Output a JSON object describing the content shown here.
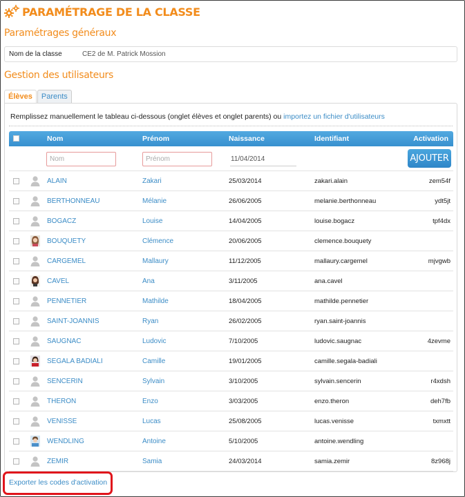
{
  "page": {
    "title": "PARAMÉTRAGE DE LA CLASSE",
    "section_general": "Paramétrages généraux",
    "section_users": "Gestion des utilisateurs"
  },
  "class_field": {
    "label": "Nom de la classe",
    "value": "CE2 de M. Patrick Mossion"
  },
  "tabs": [
    {
      "label": "Élèves",
      "active": true
    },
    {
      "label": "Parents",
      "active": false
    }
  ],
  "instructions": {
    "text": "Remplissez manuellement le tableau ci-dessous (onglet élèves et onglet parents) ou",
    "link": "importez un fichier d'utilisateurs"
  },
  "table": {
    "headers": {
      "nom": "Nom",
      "prenom": "Prénom",
      "naissance": "Naissance",
      "identifiant": "Identifiant",
      "activation": "Activation"
    },
    "add_row": {
      "nom_placeholder": "Nom",
      "prenom_placeholder": "Prénom",
      "date_value": "11/04/2014",
      "add_button": "AJOUTER"
    },
    "rows": [
      {
        "nom": "ALAIN",
        "prenom": "Zakari",
        "naissance": "25/03/2014",
        "identifiant": "zakari.alain",
        "activation": "zem54f",
        "avatar": "default"
      },
      {
        "nom": "BERTHONNEAU",
        "prenom": "Mélanie",
        "naissance": "26/06/2005",
        "identifiant": "melanie.berthonneau",
        "activation": "ydt5jt",
        "avatar": "default"
      },
      {
        "nom": "BOGACZ",
        "prenom": "Louise",
        "naissance": "14/04/2005",
        "identifiant": "louise.bogacz",
        "activation": "tpf4dx",
        "avatar": "default"
      },
      {
        "nom": "BOUQUETY",
        "prenom": "Clémence",
        "naissance": "20/06/2005",
        "identifiant": "clemence.bouquety",
        "activation": "",
        "avatar": "photo-girl"
      },
      {
        "nom": "CARGEMEL",
        "prenom": "Mallaury",
        "naissance": "11/12/2005",
        "identifiant": "mallaury.cargemel",
        "activation": "mjvgwb",
        "avatar": "default"
      },
      {
        "nom": "CAVEL",
        "prenom": "Ana",
        "naissance": "3/11/2005",
        "identifiant": "ana.cavel",
        "activation": "",
        "avatar": "photo-girl2"
      },
      {
        "nom": "PENNETIER",
        "prenom": "Mathilde",
        "naissance": "18/04/2005",
        "identifiant": "mathilde.pennetier",
        "activation": "",
        "avatar": "default"
      },
      {
        "nom": "SAINT-JOANNIS",
        "prenom": "Ryan",
        "naissance": "26/02/2005",
        "identifiant": "ryan.saint-joannis",
        "activation": "",
        "avatar": "default"
      },
      {
        "nom": "SAUGNAC",
        "prenom": "Ludovic",
        "naissance": "7/10/2005",
        "identifiant": "ludovic.saugnac",
        "activation": "4zevme",
        "avatar": "default"
      },
      {
        "nom": "SEGALA BADIALI",
        "prenom": "Camille",
        "naissance": "19/01/2005",
        "identifiant": "camille.segala-badiali",
        "activation": "",
        "avatar": "photo-girl3"
      },
      {
        "nom": "SENCERIN",
        "prenom": "Sylvain",
        "naissance": "3/10/2005",
        "identifiant": "sylvain.sencerin",
        "activation": "r4xdsh",
        "avatar": "default"
      },
      {
        "nom": "THERON",
        "prenom": "Enzo",
        "naissance": "3/03/2005",
        "identifiant": "enzo.theron",
        "activation": "deh7fb",
        "avatar": "default"
      },
      {
        "nom": "VENISSE",
        "prenom": "Lucas",
        "naissance": "25/08/2005",
        "identifiant": "lucas.venisse",
        "activation": "txmxtt",
        "avatar": "default"
      },
      {
        "nom": "WENDLING",
        "prenom": "Antoine",
        "naissance": "5/10/2005",
        "identifiant": "antoine.wendling",
        "activation": "",
        "avatar": "photo-boy"
      },
      {
        "nom": "ZEMIR",
        "prenom": "Samia",
        "naissance": "24/03/2014",
        "identifiant": "samia.zemir",
        "activation": "8z968j",
        "avatar": "default"
      }
    ]
  },
  "export_link": "Exporter les codes d'activation",
  "colors": {
    "accent": "#f28c1c",
    "link": "#3b8cc6",
    "header": "#3f97d4",
    "highlight": "#e0141b"
  }
}
